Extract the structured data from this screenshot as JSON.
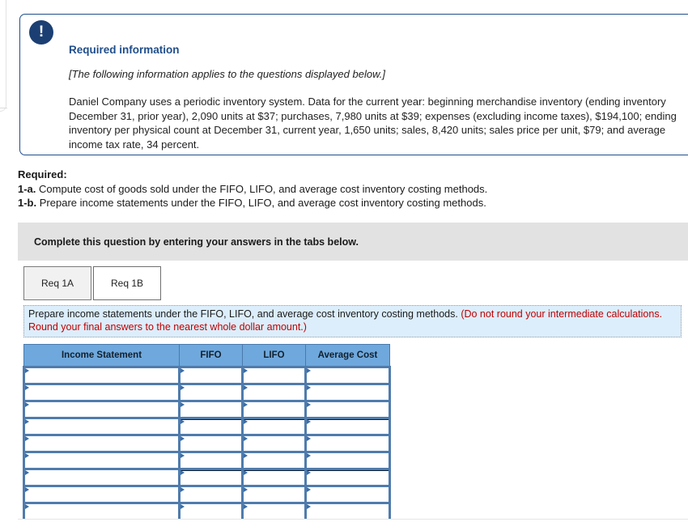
{
  "info_card": {
    "badge_icon": "exclamation-icon",
    "badge_glyph": "!",
    "title": "Required information",
    "italic_note": "[The following information applies to the questions displayed below.]",
    "paragraph": "Daniel Company uses a periodic inventory system. Data for the current year: beginning merchandise inventory (ending inventory December 31, prior year), 2,090 units at $37; purchases, 7,980 units at $39; expenses (excluding income taxes), $194,100; ending inventory per physical count at December 31, current year, 1,650 units; sales, 8,420 units; sales price per unit, $79; and average income tax rate, 34 percent."
  },
  "required": {
    "heading": "Required:",
    "items": [
      {
        "label": "1-a.",
        "text": "Compute cost of goods sold under the FIFO, LIFO, and average cost inventory costing methods."
      },
      {
        "label": "1-b.",
        "text": "Prepare income statements under the FIFO, LIFO, and average cost inventory costing methods."
      }
    ]
  },
  "complete_bar": {
    "text": "Complete this question by entering your answers in the tabs below."
  },
  "tabs": [
    {
      "label": "Req 1A",
      "active": false
    },
    {
      "label": "Req 1B",
      "active": true
    }
  ],
  "instruction": {
    "main": "Prepare income statements under the FIFO, LIFO, and average cost inventory costing methods.",
    "warning": "(Do not round your intermediate calculations. Round your final answers to the nearest whole dollar amount.)",
    "warning_color": "#c00000",
    "background_color": "#dceefb"
  },
  "answer_table": {
    "headers": [
      "Income Statement",
      "FIFO",
      "LIFO",
      "Average Cost"
    ],
    "header_color": "#6fa8dc",
    "border_color": "#4f7cad",
    "rows": [
      {
        "cells": [
          "",
          "",
          "",
          ""
        ],
        "rule_above": false
      },
      {
        "cells": [
          "",
          "",
          "",
          ""
        ],
        "rule_above": false
      },
      {
        "cells": [
          "",
          "",
          "",
          ""
        ],
        "rule_above": false
      },
      {
        "cells": [
          "",
          "",
          "",
          ""
        ],
        "rule_above": true
      },
      {
        "cells": [
          "",
          "",
          "",
          ""
        ],
        "rule_above": false
      },
      {
        "cells": [
          "",
          "",
          "",
          ""
        ],
        "rule_above": false
      },
      {
        "cells": [
          "",
          "",
          "",
          ""
        ],
        "rule_above": true
      },
      {
        "cells": [
          "",
          "",
          "",
          ""
        ],
        "rule_above": false
      },
      {
        "cells": [
          "",
          "",
          "",
          ""
        ],
        "rule_above": false
      }
    ]
  }
}
